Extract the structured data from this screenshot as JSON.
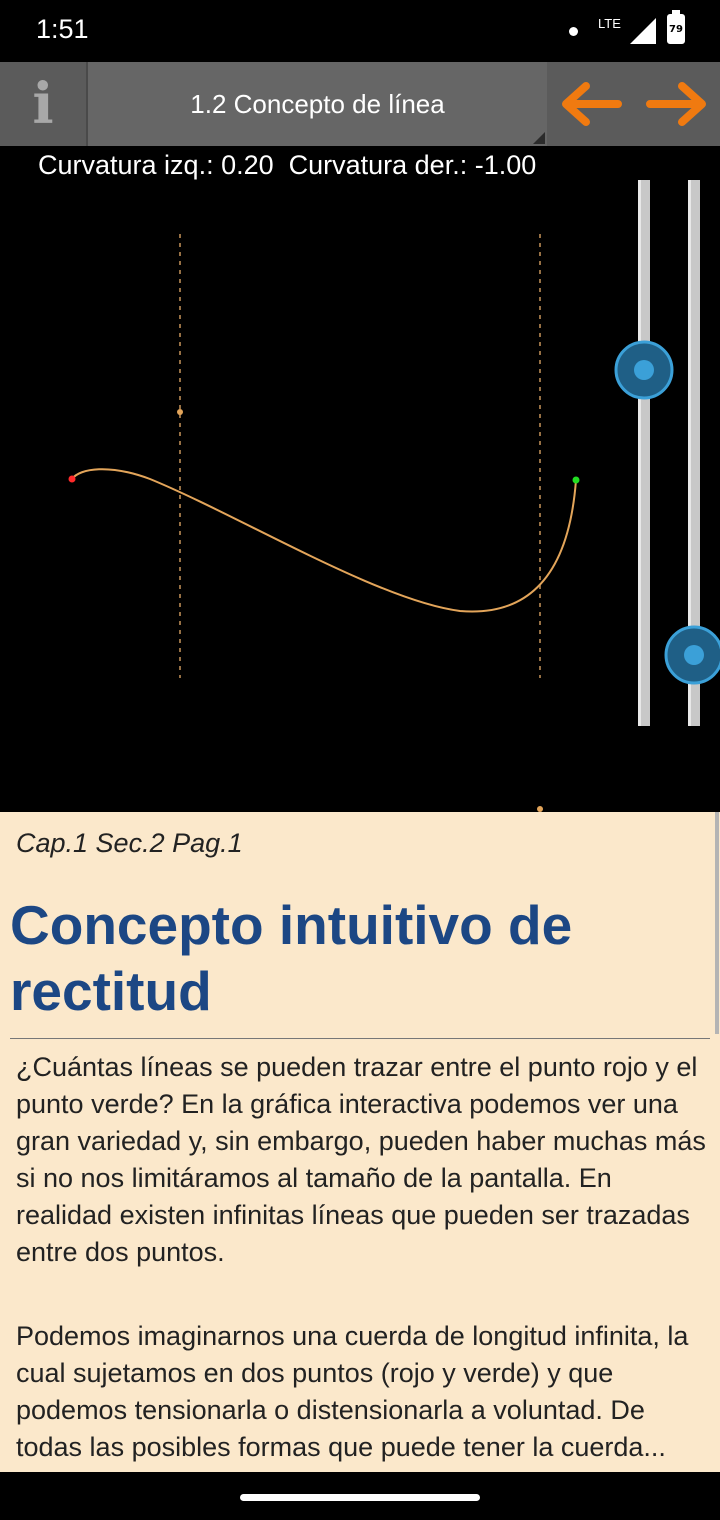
{
  "status_bar": {
    "time": "1:51",
    "network": "LTE",
    "battery_level": "79",
    "icons": [
      "notification-dot-icon",
      "lte-icon",
      "signal-icon",
      "battery-icon"
    ]
  },
  "toolbar": {
    "info_icon": "info-icon",
    "title": "1.2 Concepto de línea",
    "prev_icon": "arrow-left-icon",
    "next_icon": "arrow-right-icon",
    "accent_color": "#f07a10"
  },
  "graphic": {
    "curvature_readout": "Curvatura izq.: 0.20  Curvatura der.: -1.00",
    "curvature_left": 0.2,
    "curvature_right": -1.0,
    "colors": {
      "curve": "#e3a55a",
      "guide": "#c8965a",
      "start_point": "#ff2a2a",
      "end_point": "#22dd22",
      "slider_track": "#c8c8c8",
      "slider_thumb": "#3ba0d8"
    }
  },
  "document": {
    "page_ref": "Cap.1 Sec.2 Pag.1",
    "title": "Concepto intuitivo de rectitud",
    "paragraphs": [
      "¿Cuántas líneas se pueden trazar entre el punto rojo y el punto verde? En la gráfica interactiva podemos ver una gran variedad y, sin embargo, pueden haber muchas más si no nos limitáramos al tamaño de la pantalla. En realidad existen infinitas líneas que pueden ser trazadas entre dos puntos.",
      "Podemos imaginarnos una cuerda de longitud infinita, la cual sujetamos en dos puntos (rojo y verde) y que podemos tensionarla o distensionarla a voluntad. De todas las posibles formas que puede tener la cuerda..."
    ],
    "title_color": "#1c4784",
    "background": "#fbe8cb"
  }
}
